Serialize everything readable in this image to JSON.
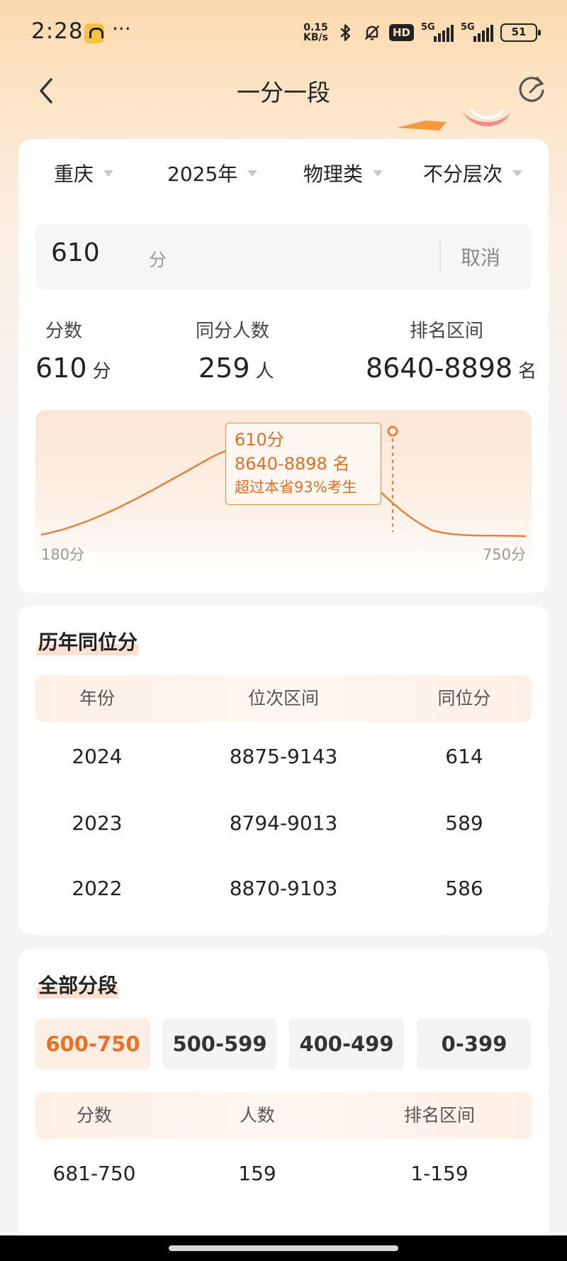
{
  "status_bar": {
    "time": "2:28",
    "dots": "···",
    "net_speed_value": "0.15",
    "net_speed_unit": "KB/s",
    "hd": "HD",
    "network_1": "5G",
    "network_2": "5G",
    "battery": "51"
  },
  "header": {
    "title": "一分一段"
  },
  "filters": {
    "province": "重庆",
    "year": "2025年",
    "subject": "物理类",
    "level": "不分层次"
  },
  "search": {
    "score_value": "610",
    "unit": "分",
    "cancel_label": "取消"
  },
  "stats": {
    "score_label": "分数",
    "score_value": "610",
    "score_unit": "分",
    "same_count_label": "同分人数",
    "same_count_value": "259",
    "same_count_unit": "人",
    "rank_label": "排名区间",
    "rank_value": "8640-8898",
    "rank_unit": "名"
  },
  "distribution": {
    "tooltip_score": "610分",
    "tooltip_rank": "8640-8898 名",
    "tooltip_percent": "超过本省93%考生",
    "x_min_label": "180分",
    "x_max_label": "750分",
    "line_color": "#e8803c"
  },
  "history": {
    "title": "历年同位分",
    "columns": [
      "年份",
      "位次区间",
      "同位分"
    ],
    "rows": [
      {
        "year": "2024",
        "rank_range": "8875-9143",
        "equiv_score": "614"
      },
      {
        "year": "2023",
        "rank_range": "8794-9013",
        "equiv_score": "589"
      },
      {
        "year": "2022",
        "rank_range": "8870-9103",
        "equiv_score": "586"
      }
    ]
  },
  "all_segments": {
    "title": "全部分段",
    "tabs": [
      "600-750",
      "500-599",
      "400-499",
      "0-399"
    ],
    "active_tab": "600-750",
    "columns": [
      "分数",
      "人数",
      "排名区间"
    ],
    "rows": [
      {
        "score": "681-750",
        "count": "159",
        "rank": "1-159"
      }
    ]
  },
  "colors": {
    "accent": "#ec6f24"
  }
}
